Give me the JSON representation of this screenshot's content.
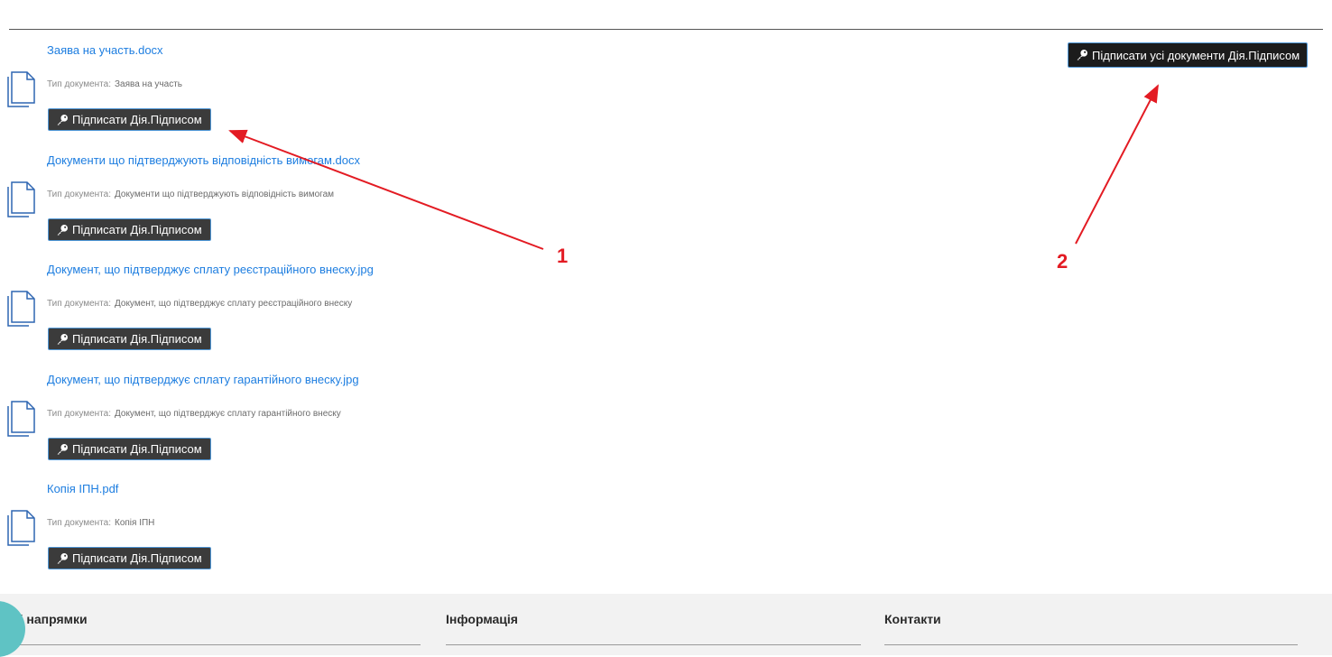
{
  "header": {
    "clipped_text": "...  ..  .  ..  ..  .  ..  ..  ..  .  .  ."
  },
  "documents": [
    {
      "filename": "Заява на участь.docx",
      "type_label": "Тип документа:",
      "type_value": "Заява на участь",
      "sign_label": "Підписати Дія.Підписом"
    },
    {
      "filename": "Документи що підтверджують відповідність вимогам.docx",
      "type_label": "Тип документа:",
      "type_value": "Документи що підтверджують відповідність вимогам",
      "sign_label": "Підписати Дія.Підписом"
    },
    {
      "filename": "Документ, що підтверджує сплату реєстраційного внеску.jpg",
      "type_label": "Тип документа:",
      "type_value": "Документ, що підтверджує сплату реєстраційного внеску",
      "sign_label": "Підписати Дія.Підписом"
    },
    {
      "filename": "Документ, що підтверджує сплату гарантійного внеску.jpg",
      "type_label": "Тип документа:",
      "type_value": "Документ, що підтверджує сплату гарантійного внеску",
      "sign_label": "Підписати Дія.Підписом"
    },
    {
      "filename": "Копія ІПН.pdf",
      "type_label": "Тип документа:",
      "type_value": "Копія ІПН",
      "sign_label": "Підписати Дія.Підписом"
    }
  ],
  "sign_all": {
    "label": "Підписати усі документи Дія.Підписом"
  },
  "annotations": {
    "one": "1",
    "two": "2"
  },
  "footer": {
    "col1": "Усі напрямки",
    "col2": "Інформація",
    "col3": "Контакти"
  },
  "colors": {
    "link": "#1e7ee0",
    "button_bg": "#3b3b3b",
    "button_border": "#4e96d6",
    "annotation": "#e31b23",
    "footer_bg": "#f2f2f2",
    "accent_teal": "#5fc3c4"
  }
}
